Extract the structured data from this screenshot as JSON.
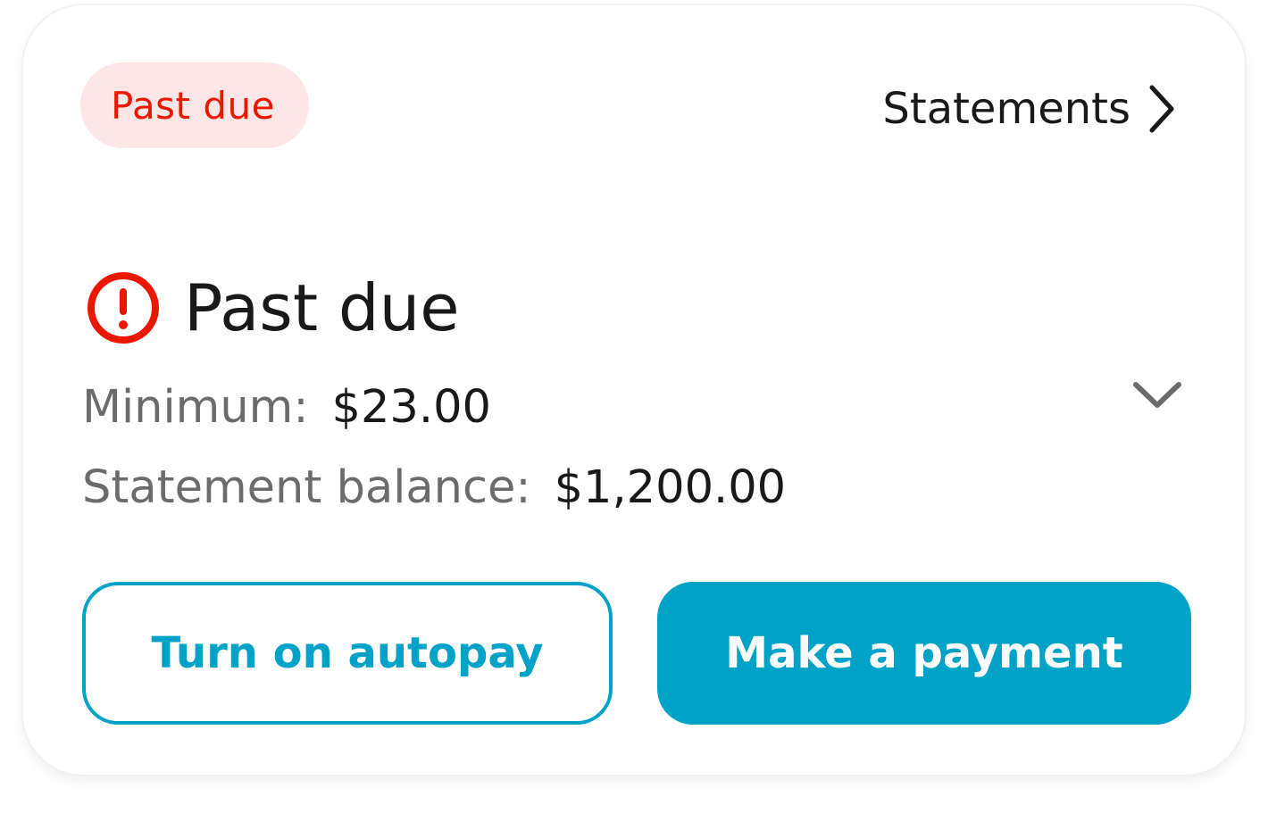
{
  "colors": {
    "brand_accent": "#00a2c7",
    "danger": "#eb1700",
    "danger_bg": "#fde6e6",
    "text_primary": "#191919",
    "text_secondary": "#6b6b6b"
  },
  "header": {
    "badge_label": "Past due",
    "statements_link": "Statements",
    "statements_icon": "chevron-right-icon"
  },
  "status": {
    "icon": "alert-circle-icon",
    "title": "Past due",
    "expand_icon": "chevron-down-icon"
  },
  "details": {
    "minimum_label": "Minimum:",
    "minimum_value": "$23.00",
    "balance_label": "Statement balance:",
    "balance_value": "$1,200.00"
  },
  "actions": {
    "autopay_label": "Turn on autopay",
    "payment_label": "Make a payment"
  }
}
